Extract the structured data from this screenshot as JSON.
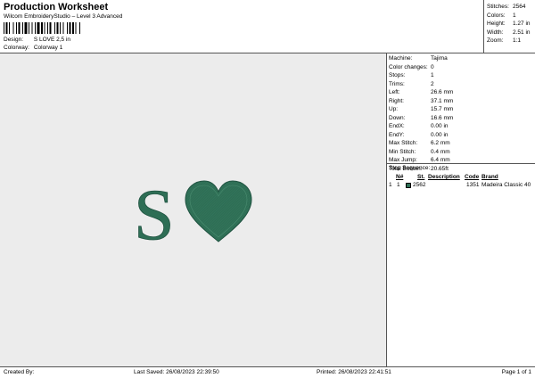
{
  "header": {
    "title": "Production Worksheet",
    "subtitle": "Wilcom EmbroideryStudio – Level 3 Advanced",
    "design_label": "Design:",
    "design_value": "S LOVE 2,5 in",
    "colorway_label": "Colorway:",
    "colorway_value": "Colorway 1"
  },
  "stats": [
    {
      "label": "Stitches:",
      "value": "2564"
    },
    {
      "label": "Colors:",
      "value": "1"
    },
    {
      "label": "Height:",
      "value": "1.27 in"
    },
    {
      "label": "Width:",
      "value": "2.51 in"
    },
    {
      "label": "Zoom:",
      "value": "1:1"
    }
  ],
  "machine_info": [
    {
      "label": "Machine:",
      "value": "Tajima"
    },
    {
      "label": "Color changes:",
      "value": "0"
    },
    {
      "label": "Stops:",
      "value": "1"
    },
    {
      "label": "Trims:",
      "value": "2"
    },
    {
      "label": "Left:",
      "value": "26.6 mm"
    },
    {
      "label": "Right:",
      "value": "37.1 mm"
    },
    {
      "label": "Up:",
      "value": "15.7 mm"
    },
    {
      "label": "Down:",
      "value": "16.6 mm"
    },
    {
      "label": "EndX:",
      "value": "0.00 in"
    },
    {
      "label": "EndY:",
      "value": "0.00 in"
    },
    {
      "label": "Max Stitch:",
      "value": "6.2 mm"
    },
    {
      "label": "Min Stitch:",
      "value": "0.4 mm"
    },
    {
      "label": "Max Jump:",
      "value": "6.4 mm"
    },
    {
      "label": "Total Bobbin:",
      "value": "20.65ft"
    }
  ],
  "stop_sequence": {
    "title": "Stop Sequence:",
    "headers": [
      "N#",
      "St.",
      "Description",
      "Code",
      "Brand"
    ],
    "rows": [
      {
        "index": "1",
        "n": "1",
        "stitches": "2562",
        "description": "",
        "code": "1351",
        "brand": "Madeira Classic 40",
        "color": "#2e6e55"
      }
    ]
  },
  "design": {
    "letter": "S",
    "thread_color": "#2e6e55",
    "thread_highlight": "#4a8c70",
    "canvas_color": "#ececec"
  },
  "footer": {
    "created_by": "Created By:",
    "last_saved": "Last Saved: 26/08/2023 22:39:50",
    "printed": "Printed: 26/08/2023 22:41:51",
    "page": "Page 1 of 1"
  }
}
